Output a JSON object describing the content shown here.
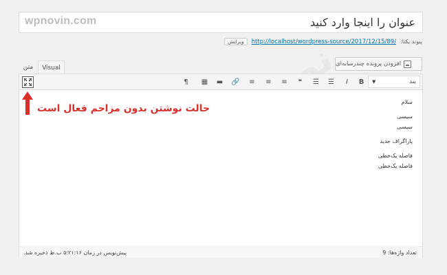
{
  "brand": "wpnovin.com",
  "title": {
    "value": "عنوان را اینجا وارد کنید"
  },
  "permalink": {
    "label": "پیوند یکتا:",
    "url": "http://localhost/wordpress-source/2017/12/15/89/",
    "edit_label": "ویرایش"
  },
  "media": {
    "add_label": "افزودن پرونده چندرسانه‌ای"
  },
  "tabs": {
    "visual": "Visual",
    "text": "متن"
  },
  "toolbar": {
    "format_selected": "بند",
    "buttons": [
      {
        "name": "paragraph-icon",
        "glyph": "¶"
      },
      {
        "name": "toolbar-toggle-icon",
        "glyph": "▦"
      },
      {
        "name": "insert-more-icon",
        "glyph": "▬"
      },
      {
        "name": "link-icon",
        "glyph": "🔗"
      },
      {
        "name": "align-right-icon",
        "glyph": "≡"
      },
      {
        "name": "align-center-icon",
        "glyph": "≡"
      },
      {
        "name": "align-left-icon",
        "glyph": "≡"
      },
      {
        "name": "blockquote-icon",
        "glyph": "❝"
      },
      {
        "name": "ordered-list-icon",
        "glyph": "☰"
      },
      {
        "name": "bullet-list-icon",
        "glyph": "☰"
      },
      {
        "name": "italic-icon",
        "glyph": "I"
      },
      {
        "name": "bold-icon",
        "glyph": "B"
      }
    ]
  },
  "content": {
    "lines": [
      {
        "text": "سلام",
        "gap": false
      },
      {
        "text": "سیسی",
        "gap": true
      },
      {
        "text": "سیسی",
        "gap": false
      },
      {
        "text": "پاراگراف جدید",
        "gap": true
      },
      {
        "text": "فاصله یک‌خطی",
        "gap": true
      },
      {
        "text": "فاصله یک‌خطی",
        "gap": false
      }
    ]
  },
  "status": {
    "word_count": "تعداد واژه‌ها: 9",
    "saved": "پیش‌نویس در زمان ۵:۲۱:۱۶ ب.ظ ذخیره شد."
  },
  "annotation": {
    "text": "حالت نوشتن بدون مزاحم فعال است",
    "color": "#d9302b"
  }
}
